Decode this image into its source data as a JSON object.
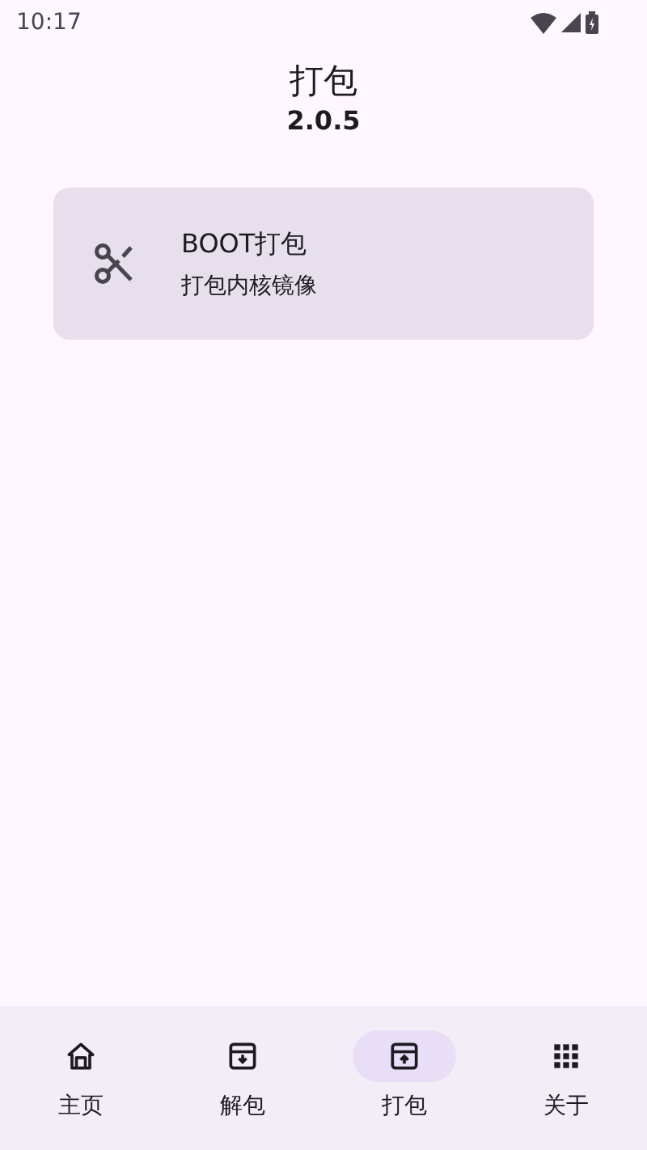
{
  "status_bar": {
    "time": "10:17"
  },
  "header": {
    "title": "打包",
    "version": "2.0.5"
  },
  "cards": [
    {
      "title": "BOOT打包",
      "subtitle": "打包内核镜像"
    }
  ],
  "nav": [
    {
      "label": "主页",
      "selected": false
    },
    {
      "label": "解包",
      "selected": false
    },
    {
      "label": "打包",
      "selected": true
    },
    {
      "label": "关于",
      "selected": false
    }
  ]
}
